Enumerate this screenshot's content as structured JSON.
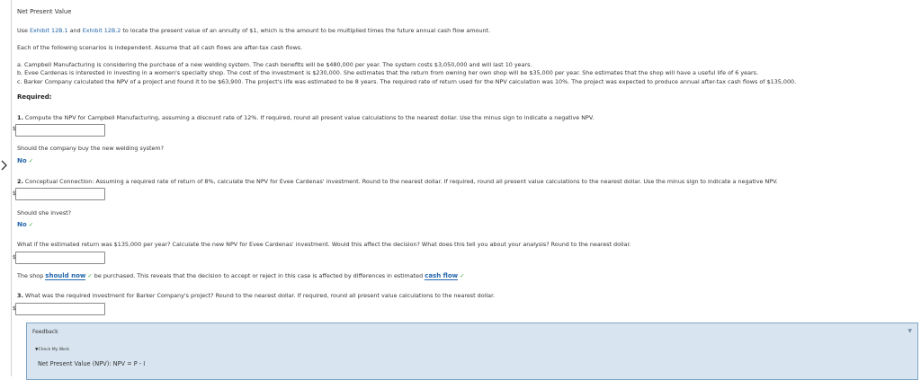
{
  "page_title": "Net Present Value",
  "intro": {
    "prefix": "Use ",
    "link1": "Exhibit 12B.1",
    "middle": " and ",
    "link2": "Exhibit 12B.2",
    "suffix": " to locate the present value of an annuity of $1, which is the amount to be multiplied times the future annual cash flow amount."
  },
  "independence_note": "Each of the following scenarios is independent. Assume that all cash flows are after-tax cash flows.",
  "scenarios": [
    "a. Campbell Manufacturing is considering the purchase of a new welding system. The cash benefits will be $480,000 per year. The system costs $3,050,000 and will last 10 years.",
    "b. Evee Cardenas is interested in investing in a women's specialty shop. The cost of the investment is $230,000. She estimates that the return from owning her own shop will be $35,000 per year. She estimates that the shop will have a useful life of 6 years.",
    "c. Barker Company calculated the NPV of a project and found it to be $63,900. The project's life was estimated to be 8 years. The required rate of return used for the NPV calculation was 10%. The project was expected to produce annual after-tax cash flows of $135,000."
  ],
  "required_label": "Required:",
  "q1": {
    "number": "1.",
    "text": " Compute the NPV for Campbell Manufacturing, assuming a discount rate of 12%. If required, round all present value calculations to the nearest dollar. Use the minus sign to indicate a negative NPV.",
    "dollar": "$",
    "input_value": "",
    "followup": "Should the company buy the new welding system?",
    "answer": "No",
    "check": "✓"
  },
  "q2": {
    "number": "2.",
    "text": " Conceptual Connection: Assuming a required rate of return of 8%, calculate the NPV for Evee Cardenas' investment. Round to the nearest dollar. If required, round all present value calculations to the nearest dollar. Use the minus sign to indicate a negative NPV.",
    "dollar": "$",
    "input_value": "",
    "followup": "Should she invest?",
    "answer": "No",
    "check": "✓",
    "whatif": "What if the estimated return was $135,000 per year? Calculate the new NPV for Evee Cardenas' investment. Would this affect the decision? What does this tell you about your analysis? Round to the nearest dollar.",
    "dollar2": "$",
    "input2_value": "",
    "sentence": {
      "part1": "The shop ",
      "answer1": "should now",
      "check1": "✓",
      "part2": " be purchased. This reveals that the decision to accept or reject in this case is affected by differences in estimated ",
      "answer2": "cash flow",
      "check2": "✓"
    }
  },
  "q3": {
    "number": "3.",
    "text": " What was the required investment for Barker Company's project? Round to the nearest dollar. If required, round all present value calculations to the nearest dollar.",
    "dollar": "$",
    "input_value": ""
  },
  "feedback": {
    "title": "Feedback",
    "caret": "▼",
    "check_my_work": "▼Check My Work",
    "formula": "Net Present Value (NPV): NPV = P - I"
  },
  "colors": {
    "link": "#2266aa",
    "check": "#3aaa35",
    "feedback_bg": "#d8e5f0",
    "feedback_border": "#7ea6c4"
  },
  "icons": {
    "nav": "chevron-right-icon",
    "check": "check-icon",
    "feedback_toggle": "caret-down-icon"
  }
}
